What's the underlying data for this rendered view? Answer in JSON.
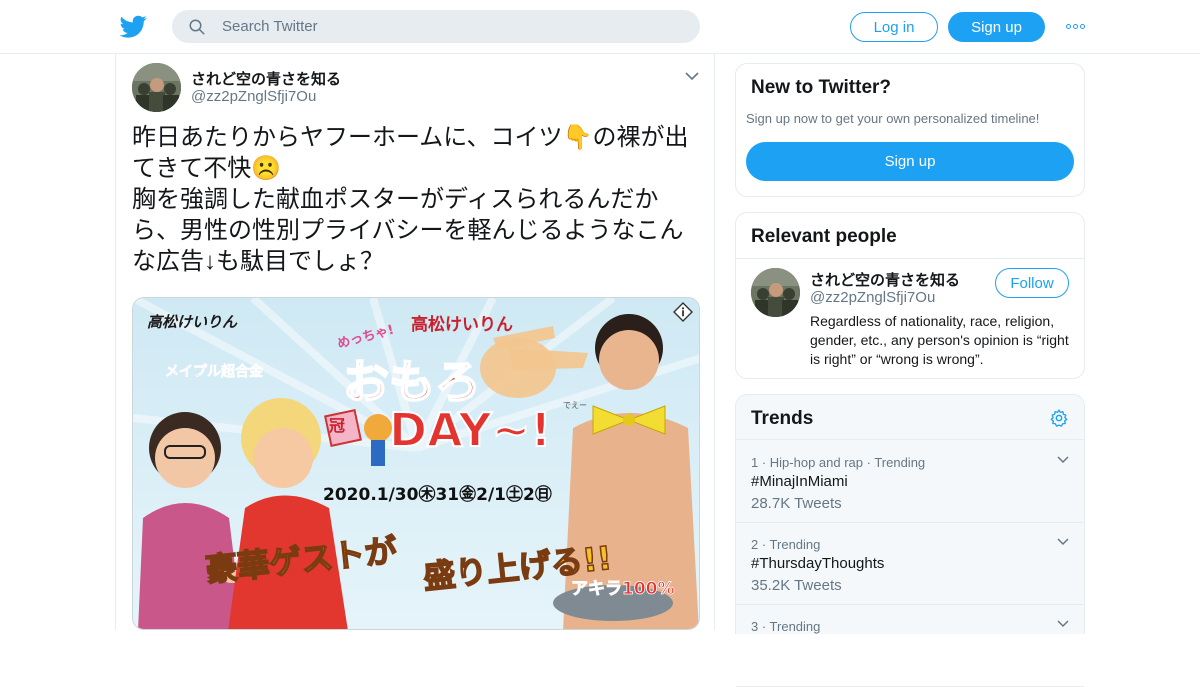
{
  "header": {
    "logo_icon": "twitter-bird-icon",
    "search_placeholder": "Search Twitter",
    "login_label": "Log in",
    "signup_label": "Sign up",
    "more_icon": "more-dots-icon",
    "accent_color": "#1da1f2"
  },
  "tweet": {
    "display_name": "されど空の青さを知る",
    "screen_name": "@zz2pZnglSfji7Ou",
    "text": "昨日あたりからヤフーホームに、コイツ👇の裸が出\nてきて不快☹️\n胸を強調した献血ポスターがディスられるんだか\nら、男性の性別プライバシーを軽んじるようなこん\nな広告↓も駄目でしょ？",
    "media": {
      "brand": "高松けいりん",
      "bonus": "メイプル超合金",
      "badge_small": "めっちゃ!",
      "headline_top": "高松けいりん",
      "headline_main": "おもろ",
      "headline_day": "DAY~!",
      "day_ruby": "でえー",
      "kanmuri": "冠",
      "dates": "2020.1/30㊍31㊎2/1㊏2㊐",
      "slogan_left": "豪華ゲストが",
      "slogan_right": "盛り上げる!!",
      "guest": "アキラ100%"
    }
  },
  "sidebar": {
    "new_to_twitter": {
      "title": "New to Twitter?",
      "subtitle": "Sign up now to get your own personalized timeline!",
      "signup_label": "Sign up"
    },
    "relevant_people": {
      "title": "Relevant people",
      "name": "されど空の青さを知る",
      "handle": "@zz2pZnglSfji7Ou",
      "follow_label": "Follow",
      "bio": "Regardless of nationality, race, religion, gender, etc., any person's opinion is “right is right” or “wrong is wrong”."
    },
    "trends": {
      "title": "Trends",
      "items": [
        {
          "meta": "1 · Hip-hop and rap · Trending",
          "name": "#MinajInMiami",
          "count": "28.7K Tweets"
        },
        {
          "meta": "2 · Trending",
          "name": "#ThursdayThoughts",
          "count": "35.2K Tweets"
        },
        {
          "meta": "3 · Trending",
          "name": "",
          "count": ""
        }
      ]
    }
  }
}
